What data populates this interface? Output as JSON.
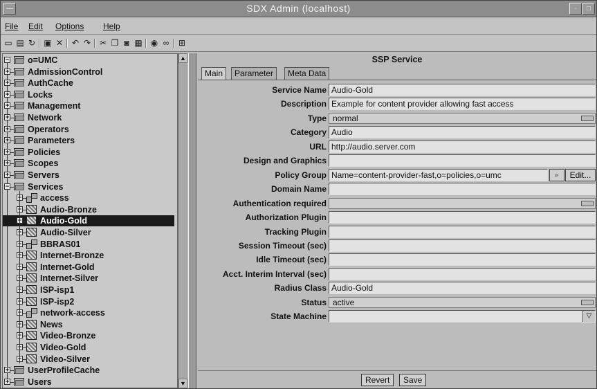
{
  "window": {
    "title": "SDX Admin (localhost)"
  },
  "menu": [
    "File",
    "Edit",
    "Options",
    "Help"
  ],
  "toolbar_icons": [
    "new-icon",
    "save-icon",
    "refresh-icon",
    "disk-icon",
    "delete-icon",
    "undo-icon",
    "redo-icon",
    "cut-icon",
    "copy-icon",
    "camera-icon",
    "paste-icon",
    "view-icon",
    "link-icon",
    "properties-icon"
  ],
  "tree": {
    "root": "o=UMC",
    "items": [
      {
        "label": "AdmissionControl",
        "icon": "folder"
      },
      {
        "label": "AuthCache",
        "icon": "folder"
      },
      {
        "label": "Locks",
        "icon": "folder"
      },
      {
        "label": "Management",
        "icon": "folder"
      },
      {
        "label": "Network",
        "icon": "folder"
      },
      {
        "label": "Operators",
        "icon": "folder"
      },
      {
        "label": "Parameters",
        "icon": "folder"
      },
      {
        "label": "Policies",
        "icon": "folder"
      },
      {
        "label": "Scopes",
        "icon": "folder"
      },
      {
        "label": "Servers",
        "icon": "folder"
      },
      {
        "label": "Services",
        "icon": "folder"
      },
      {
        "label": "access",
        "icon": "access"
      },
      {
        "label": "Audio-Bronze",
        "icon": "service"
      },
      {
        "label": "Audio-Gold",
        "icon": "service",
        "selected": true
      },
      {
        "label": "Audio-Silver",
        "icon": "service"
      },
      {
        "label": "BBRAS01",
        "icon": "access"
      },
      {
        "label": "Internet-Bronze",
        "icon": "service"
      },
      {
        "label": "Internet-Gold",
        "icon": "service"
      },
      {
        "label": "Internet-Silver",
        "icon": "service"
      },
      {
        "label": "ISP-isp1",
        "icon": "service"
      },
      {
        "label": "ISP-isp2",
        "icon": "service"
      },
      {
        "label": "network-access",
        "icon": "access"
      },
      {
        "label": "News",
        "icon": "service"
      },
      {
        "label": "Video-Bronze",
        "icon": "service"
      },
      {
        "label": "Video-Gold",
        "icon": "service"
      },
      {
        "label": "Video-Silver",
        "icon": "service"
      },
      {
        "label": "UserProfileCache",
        "icon": "folder"
      },
      {
        "label": "Users",
        "icon": "folder"
      }
    ]
  },
  "panel": {
    "title": "SSP Service",
    "tabs": [
      "Main",
      "Parameter",
      "Meta Data"
    ],
    "fields": [
      {
        "label": "Service Name",
        "value": "Audio-Gold",
        "kind": "text"
      },
      {
        "label": "Description",
        "value": "Example for content provider allowing fast access",
        "kind": "text"
      },
      {
        "label": "Type",
        "value": "normal",
        "kind": "combo"
      },
      {
        "label": "Category",
        "value": "Audio",
        "kind": "text"
      },
      {
        "label": "URL",
        "value": "http://audio.server.com",
        "kind": "text"
      },
      {
        "label": "Design and Graphics",
        "value": "",
        "kind": "text"
      },
      {
        "label": "Policy Group",
        "value": "Name=content-provider-fast,o=policies,o=umc",
        "kind": "policy"
      },
      {
        "label": "Domain Name",
        "value": "",
        "kind": "text"
      },
      {
        "label": "Authentication required",
        "value": "",
        "kind": "combo"
      },
      {
        "label": "Authorization Plugin",
        "value": "",
        "kind": "text"
      },
      {
        "label": "Tracking Plugin",
        "value": "",
        "kind": "text"
      },
      {
        "label": "Session Timeout (sec)",
        "value": "",
        "kind": "text"
      },
      {
        "label": "Idle Timeout (sec)",
        "value": "",
        "kind": "text"
      },
      {
        "label": "Acct. Interim Interval (sec)",
        "value": "",
        "kind": "text"
      },
      {
        "label": "Radius Class",
        "value": "Audio-Gold",
        "kind": "text"
      },
      {
        "label": "Status",
        "value": "active",
        "kind": "combo"
      },
      {
        "label": "State Machine",
        "value": "",
        "kind": "editcombo"
      }
    ],
    "edit_button": "Edit...",
    "revert_button": "Revert",
    "save_button": "Save"
  }
}
